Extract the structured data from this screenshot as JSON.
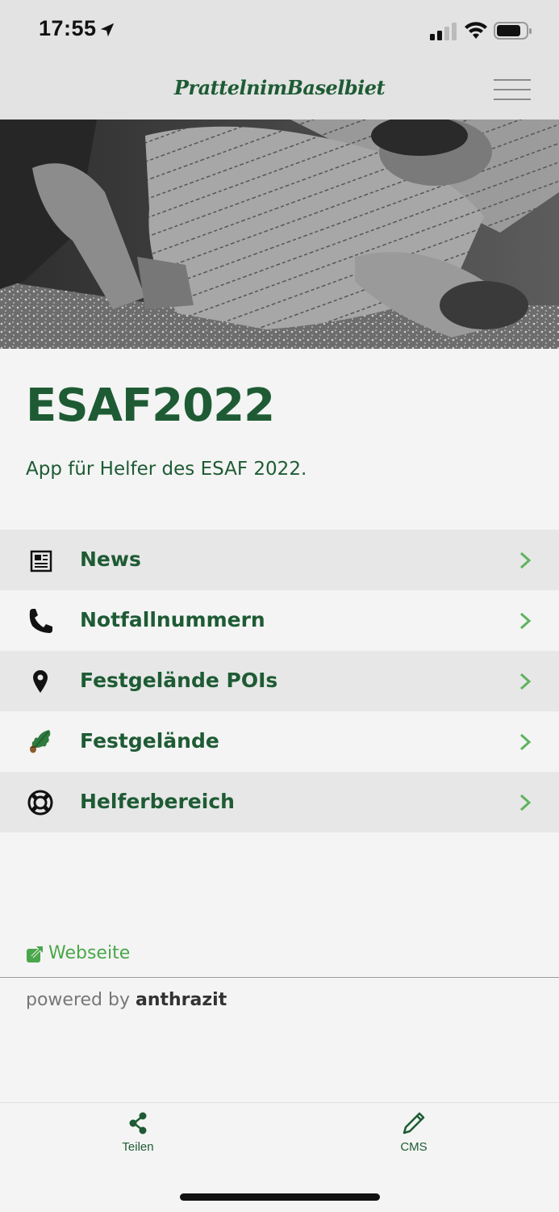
{
  "status_bar": {
    "time": "17:55"
  },
  "header": {
    "logo_text": "PrattelnimBaselbiet",
    "menu_icon": "hamburger-menu-icon"
  },
  "intro": {
    "title": "ESAF2022",
    "subtitle": "App für Helfer des ESAF 2022."
  },
  "menu": {
    "items": [
      {
        "label": "News",
        "icon": "newspaper-icon"
      },
      {
        "label": "Notfallnummern",
        "icon": "phone-icon"
      },
      {
        "label": "Festgelände POIs",
        "icon": "map-pin-icon"
      },
      {
        "label": "Festgelände",
        "icon": "oak-leaf-icon"
      },
      {
        "label": "Helferbereich",
        "icon": "lifebuoy-icon"
      }
    ]
  },
  "footer": {
    "website_label": "Webseite",
    "powered_prefix": "powered by",
    "powered_brand": "anthrazit"
  },
  "tabbar": {
    "share_label": "Teilen",
    "cms_label": "CMS"
  },
  "colors": {
    "brand_green": "#1e5b34",
    "link_green": "#4aa64a",
    "chevron_green": "#5fb35f",
    "alt_row": "#e7e7e7"
  }
}
